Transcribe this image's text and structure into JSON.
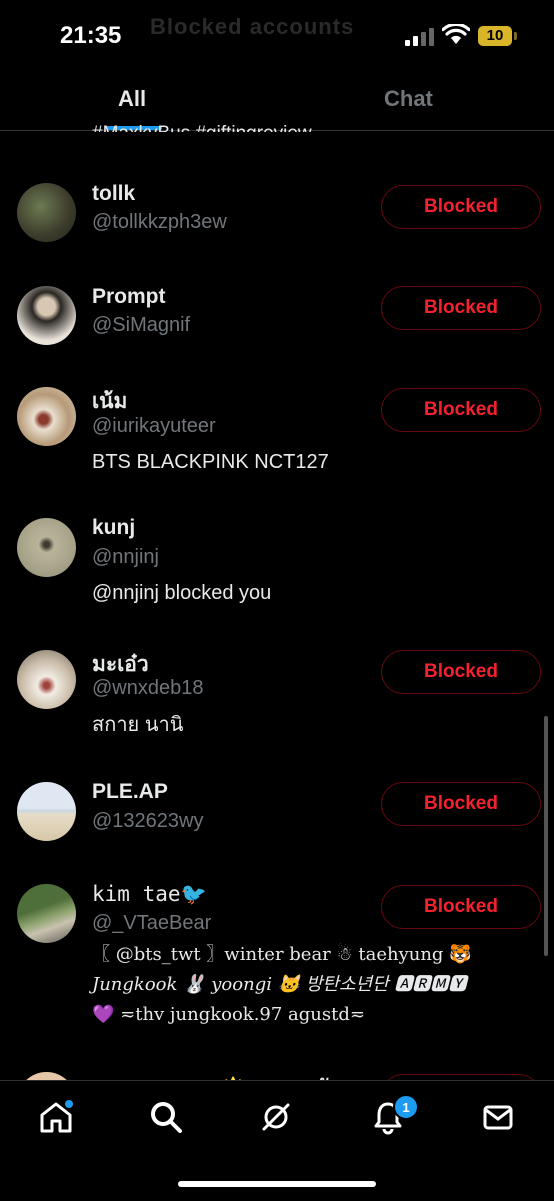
{
  "status": {
    "time": "21:35",
    "battery": "10",
    "ghost_title": "Blocked accounts"
  },
  "tabs": [
    {
      "label": "All"
    },
    {
      "label": "Chat"
    }
  ],
  "clipped_text": "#MaxkyBus #giftingreview",
  "action_label": "Blocked",
  "rows": [
    {
      "name": "tollk",
      "handle": "@tollkkzph3ew",
      "bio": "",
      "blocked": true
    },
    {
      "name": "Prompt",
      "handle": "@SiMagnif",
      "bio": "",
      "blocked": true
    },
    {
      "name": "เน้ม",
      "handle": "@iurikayuteer",
      "bio": "BTS BLACKPINK NCT127",
      "blocked": true
    },
    {
      "name": "kunj",
      "handle": "@nnjinj",
      "bio": "@nnjinj blocked you",
      "blocked": false
    },
    {
      "name": "มะเอ๋ว",
      "handle": "@wnxdeb18",
      "bio": "สกาย นานิ",
      "blocked": true
    },
    {
      "name": "PLE.AP",
      "handle": "@132623wy",
      "bio": "",
      "blocked": true
    },
    {
      "name": "kim tae🐦",
      "handle": "@_VTaeBear",
      "bio_lines": [
        "〖 @bts_twt 〗winter bear ☃ taehyung 🐯",
        "Jungkook 🐰 yoongi 🐱 방탄소년단 🅰🆁🅼🆈",
        "💜 ≂thv jungkook.97 agustd≂"
      ],
      "blocked": true
    }
  ],
  "bottom_peek": "DUOTICKET 🌟 ดูดบางบัด",
  "nav": {
    "notifications_badge": "1",
    "items": [
      "home-icon",
      "search-icon",
      "grok-icon",
      "bell-icon",
      "mail-icon"
    ]
  }
}
